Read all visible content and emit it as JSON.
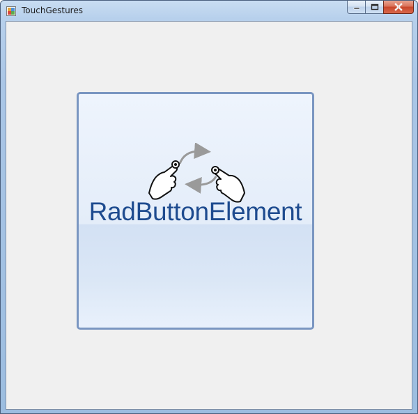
{
  "window": {
    "title": "TouchGestures"
  },
  "icons": {
    "app": "app-window-icon",
    "minimize": "minimize-icon",
    "maximize": "maximize-icon",
    "close": "close-icon",
    "gesture": "touch-rotate-gesture-icon"
  },
  "colors": {
    "button_border": "#7a96c1",
    "button_text": "#1e4b8f",
    "client_background": "#f0f0f0"
  },
  "rad_button": {
    "label": "RadButtonElement"
  }
}
